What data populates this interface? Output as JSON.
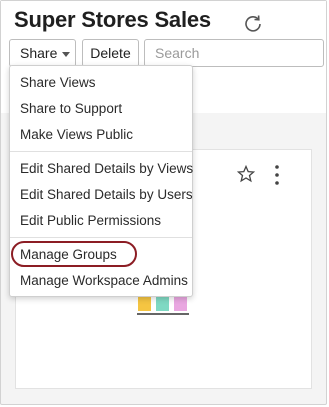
{
  "header": {
    "title": "Super Stores Sales",
    "refresh_icon": "refresh-icon"
  },
  "toolbar": {
    "share_label": "Share",
    "delete_label": "Delete",
    "search_placeholder": "Search"
  },
  "share_menu": {
    "items": [
      "Share Views",
      "Share to Support",
      "Make Views Public",
      "Edit Shared Details by Views",
      "Edit Shared Details by Users",
      "Edit Public Permissions",
      "Manage Groups",
      "Manage Workspace Admins"
    ],
    "highlighted_item": "Manage Groups",
    "highlight_color": "#8c1d24"
  },
  "card": {
    "star_icon": "star-outline-icon",
    "more_icon": "vertical-more-icon",
    "thumbnail_colors": [
      "#f5c542",
      "#7fd9c3",
      "#e9a6e0"
    ]
  }
}
